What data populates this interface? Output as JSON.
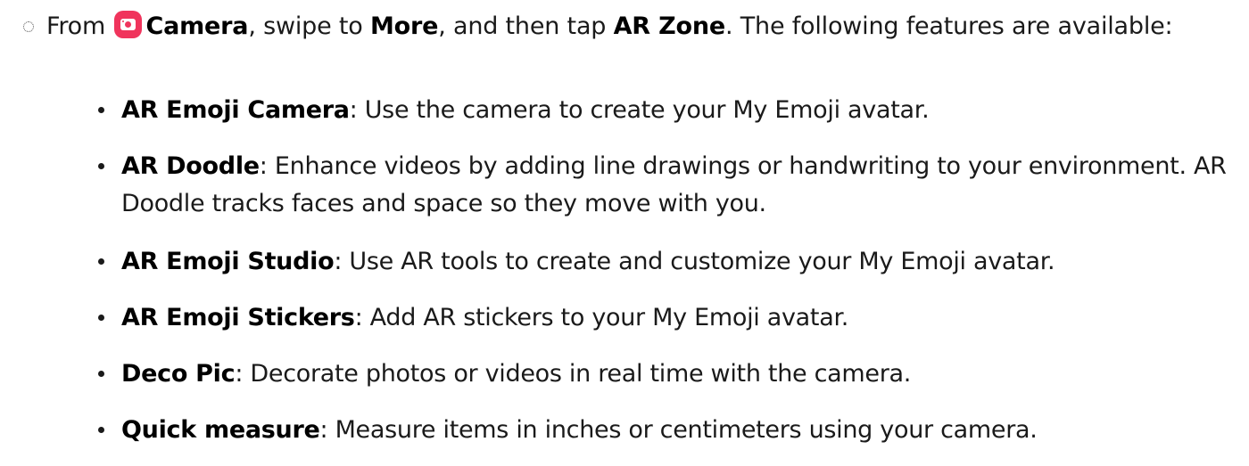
{
  "instruction": {
    "from": "From",
    "app_name": "Camera",
    "mid1": ", swipe to ",
    "more": "More",
    "mid2": ", and then tap ",
    "ar_zone": "AR Zone",
    "end": ". The following features are available:",
    "icon": "camera-app-icon"
  },
  "features": [
    {
      "term": "AR Emoji Camera",
      "desc": ": Use the camera to create your My Emoji avatar."
    },
    {
      "term": "AR Doodle",
      "desc": ": Enhance videos by adding line drawings or handwriting to your environment. AR Doodle tracks faces and space so they move with you."
    },
    {
      "term": "AR Emoji Studio",
      "desc": ": Use AR tools to create and customize your My Emoji avatar."
    },
    {
      "term": "AR Emoji Stickers",
      "desc": ": Add AR stickers to your My Emoji avatar."
    },
    {
      "term": "Deco Pic",
      "desc": ": Decorate photos or videos in real time with the camera."
    },
    {
      "term": "Quick measure",
      "desc": ": Measure items in inches or centimeters using your camera."
    }
  ],
  "colors": {
    "camera_icon": "#f0345c",
    "text": "#1a1a1a"
  }
}
